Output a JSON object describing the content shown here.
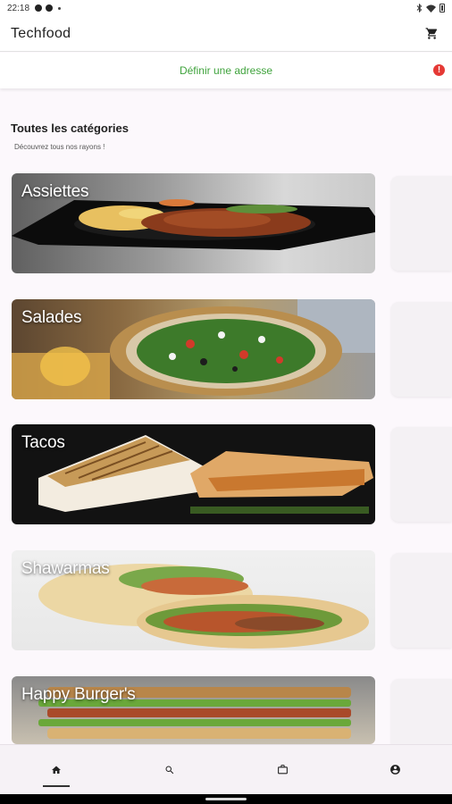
{
  "status_bar": {
    "time": "22:18"
  },
  "app_bar": {
    "title": "Techfood",
    "cart_icon": "shopping-cart-icon"
  },
  "address": {
    "label": "Définir une adresse",
    "alert_icon": "alert-icon",
    "alert_color": "#e53935",
    "label_color": "#3fa33c"
  },
  "categories": {
    "title": "Toutes les catégories",
    "subtitle": "Découvrez tous nos rayons !",
    "items": [
      {
        "label": "Assiettes"
      },
      {
        "label": "Salades"
      },
      {
        "label": "Tacos"
      },
      {
        "label": "Shawarmas"
      },
      {
        "label": "Happy Burger's"
      }
    ]
  },
  "bottom_nav": {
    "items": [
      {
        "icon": "home-icon",
        "active": true
      },
      {
        "icon": "search-icon",
        "active": false
      },
      {
        "icon": "briefcase-icon",
        "active": false
      },
      {
        "icon": "account-icon",
        "active": false
      }
    ]
  }
}
